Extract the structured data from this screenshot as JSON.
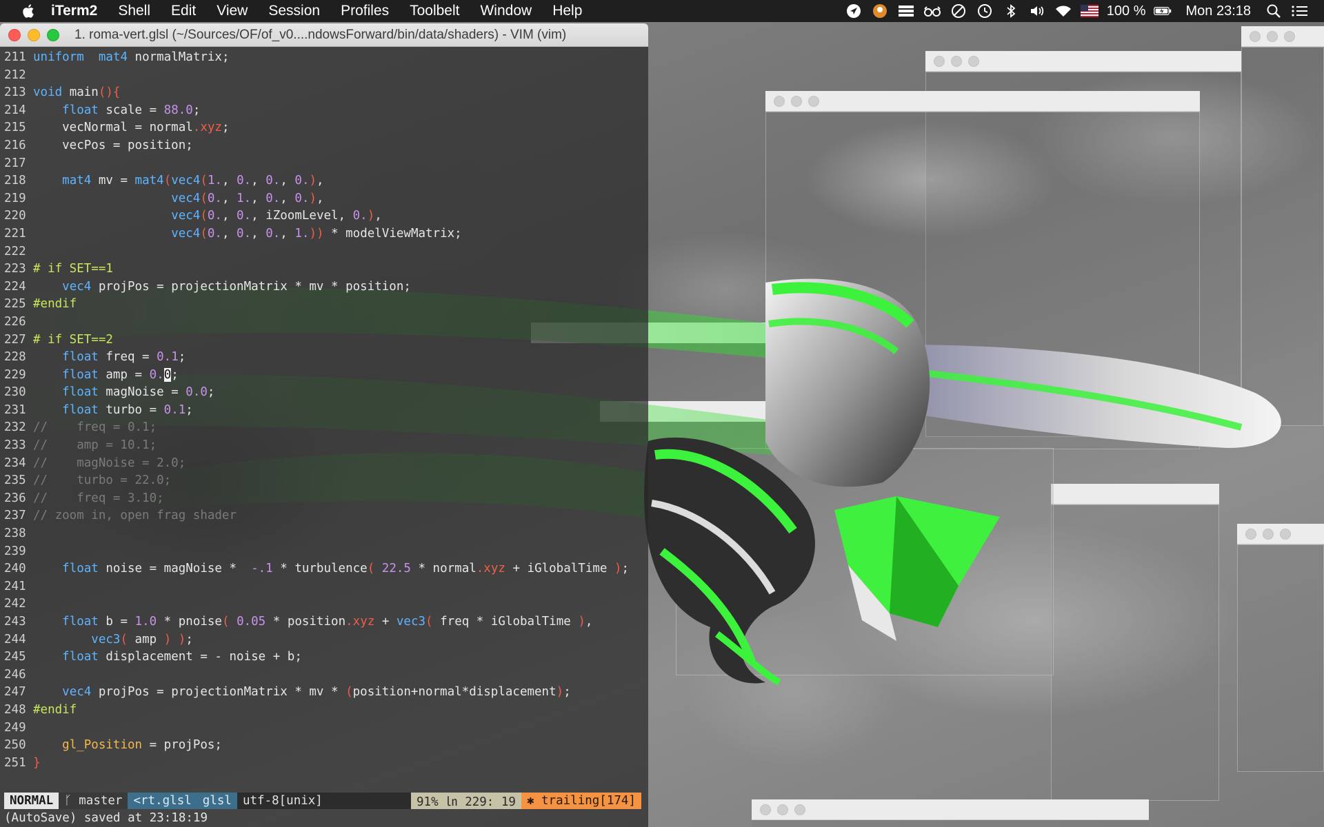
{
  "menubar": {
    "apple_icon": "apple-icon",
    "app_name": "iTerm2",
    "items": [
      "Shell",
      "Edit",
      "View",
      "Session",
      "Profiles",
      "Toolbelt",
      "Window",
      "Help"
    ],
    "status_icons": [
      "location-icon",
      "activity-icon",
      "stacks-icon",
      "glasses-icon",
      "do-not-disturb-icon",
      "time-machine-icon",
      "bluetooth-icon",
      "volume-icon",
      "wifi-icon",
      "flag-us-icon"
    ],
    "battery_text": "100 %",
    "battery_icon": "battery-charging-icon",
    "clock": "Mon 23:18",
    "search_icon": "spotlight-search-icon",
    "list_icon": "notification-center-icon"
  },
  "iterm": {
    "title": "1. roma-vert.glsl (~/Sources/OF/of_v0....ndowsForward/bin/data/shaders) - VIM (vim)",
    "lines": [
      {
        "n": "211",
        "tokens": [
          [
            "kw",
            "uniform"
          ],
          [
            "",
            "  "
          ],
          [
            "kw",
            "mat4"
          ],
          [
            "",
            " normalMatrix;"
          ]
        ]
      },
      {
        "n": "212",
        "tokens": []
      },
      {
        "n": "213",
        "tokens": [
          [
            "kw",
            "void"
          ],
          [
            "",
            " main"
          ],
          [
            "sw",
            "(){"
          ]
        ]
      },
      {
        "n": "214",
        "tokens": [
          [
            "",
            "    "
          ],
          [
            "kw",
            "float"
          ],
          [
            "",
            " scale = "
          ],
          [
            "num",
            "88.0"
          ],
          [
            "",
            ";"
          ]
        ]
      },
      {
        "n": "215",
        "tokens": [
          [
            "",
            "    vecNormal = normal"
          ],
          [
            "sw",
            ".xyz"
          ],
          [
            "",
            ";"
          ]
        ]
      },
      {
        "n": "216",
        "tokens": [
          [
            "",
            "    vecPos = position;"
          ]
        ]
      },
      {
        "n": "217",
        "tokens": []
      },
      {
        "n": "218",
        "tokens": [
          [
            "",
            "    "
          ],
          [
            "kw",
            "mat4"
          ],
          [
            "",
            " mv = "
          ],
          [
            "kw",
            "mat4"
          ],
          [
            "sw",
            "("
          ],
          [
            "kw",
            "vec4"
          ],
          [
            "sw",
            "("
          ],
          [
            "num",
            "1."
          ],
          [
            "",
            ", "
          ],
          [
            "num",
            "0."
          ],
          [
            "",
            ", "
          ],
          [
            "num",
            "0."
          ],
          [
            "",
            ", "
          ],
          [
            "num",
            "0."
          ],
          [
            "sw",
            ")"
          ],
          [
            "",
            ","
          ]
        ]
      },
      {
        "n": "219",
        "tokens": [
          [
            "",
            "                   "
          ],
          [
            "kw",
            "vec4"
          ],
          [
            "sw",
            "("
          ],
          [
            "num",
            "0."
          ],
          [
            "",
            ", "
          ],
          [
            "num",
            "1."
          ],
          [
            "",
            ", "
          ],
          [
            "num",
            "0."
          ],
          [
            "",
            ", "
          ],
          [
            "num",
            "0."
          ],
          [
            "sw",
            ")"
          ],
          [
            "",
            ","
          ]
        ]
      },
      {
        "n": "220",
        "tokens": [
          [
            "",
            "                   "
          ],
          [
            "kw",
            "vec4"
          ],
          [
            "sw",
            "("
          ],
          [
            "num",
            "0."
          ],
          [
            "",
            ", "
          ],
          [
            "num",
            "0."
          ],
          [
            "",
            ", iZoomLevel, "
          ],
          [
            "num",
            "0."
          ],
          [
            "sw",
            ")"
          ],
          [
            "",
            ","
          ]
        ]
      },
      {
        "n": "221",
        "tokens": [
          [
            "",
            "                   "
          ],
          [
            "kw",
            "vec4"
          ],
          [
            "sw",
            "("
          ],
          [
            "num",
            "0."
          ],
          [
            "",
            ", "
          ],
          [
            "num",
            "0."
          ],
          [
            "",
            ", "
          ],
          [
            "num",
            "0."
          ],
          [
            "",
            ", "
          ],
          [
            "num",
            "1."
          ],
          [
            "sw",
            "))"
          ],
          [
            "",
            " * modelViewMatrix;"
          ]
        ]
      },
      {
        "n": "222",
        "tokens": []
      },
      {
        "n": "223",
        "tokens": [
          [
            "pre",
            "# if SET==1"
          ]
        ]
      },
      {
        "n": "224",
        "tokens": [
          [
            "",
            "    "
          ],
          [
            "kw",
            "vec4"
          ],
          [
            "",
            " projPos = projectionMatrix * mv * position;"
          ]
        ]
      },
      {
        "n": "225",
        "tokens": [
          [
            "pre",
            "#endif"
          ]
        ]
      },
      {
        "n": "226",
        "tokens": []
      },
      {
        "n": "227",
        "tokens": [
          [
            "pre",
            "# if SET==2"
          ]
        ]
      },
      {
        "n": "228",
        "tokens": [
          [
            "",
            "    "
          ],
          [
            "kw",
            "float"
          ],
          [
            "",
            " freq = "
          ],
          [
            "num",
            "0.1"
          ],
          [
            "",
            ";"
          ]
        ]
      },
      {
        "n": "229",
        "tokens": [
          [
            "",
            "    "
          ],
          [
            "kw",
            "float"
          ],
          [
            "",
            " amp = "
          ],
          [
            "num",
            "0."
          ],
          [
            "cursor",
            "0"
          ],
          [
            "",
            ";"
          ]
        ]
      },
      {
        "n": "230",
        "tokens": [
          [
            "",
            "    "
          ],
          [
            "kw",
            "float"
          ],
          [
            "",
            " magNoise = "
          ],
          [
            "num",
            "0.0"
          ],
          [
            "",
            ";"
          ]
        ]
      },
      {
        "n": "231",
        "tokens": [
          [
            "",
            "    "
          ],
          [
            "kw",
            "float"
          ],
          [
            "",
            " turbo = "
          ],
          [
            "num",
            "0.1"
          ],
          [
            "",
            ";"
          ]
        ]
      },
      {
        "n": "232",
        "tokens": [
          [
            "cm",
            "//    freq = 0.1;"
          ]
        ]
      },
      {
        "n": "233",
        "tokens": [
          [
            "cm",
            "//    amp = 10.1;"
          ]
        ]
      },
      {
        "n": "234",
        "tokens": [
          [
            "cm",
            "//    magNoise = 2.0;"
          ]
        ]
      },
      {
        "n": "235",
        "tokens": [
          [
            "cm",
            "//    turbo = 22.0;"
          ]
        ]
      },
      {
        "n": "236",
        "tokens": [
          [
            "cm",
            "//    freq = 3.10;"
          ]
        ]
      },
      {
        "n": "237",
        "tokens": [
          [
            "cm",
            "// zoom in, open frag shader"
          ]
        ]
      },
      {
        "n": "238",
        "tokens": []
      },
      {
        "n": "239",
        "tokens": []
      },
      {
        "n": "240",
        "tokens": [
          [
            "",
            "    "
          ],
          [
            "kw",
            "float"
          ],
          [
            "",
            " noise = magNoise *  "
          ],
          [
            "num",
            "-.1"
          ],
          [
            "",
            " * turbulence"
          ],
          [
            "sw",
            "("
          ],
          [
            "",
            " "
          ],
          [
            "num",
            "22.5"
          ],
          [
            "",
            " * normal"
          ],
          [
            "sw",
            ".xyz"
          ],
          [
            "",
            " + iGlobalTime "
          ],
          [
            "sw",
            ")"
          ],
          [
            "",
            ";"
          ]
        ]
      },
      {
        "n": "241",
        "tokens": []
      },
      {
        "n": "242",
        "tokens": []
      },
      {
        "n": "243",
        "tokens": [
          [
            "",
            "    "
          ],
          [
            "kw",
            "float"
          ],
          [
            "",
            " b = "
          ],
          [
            "num",
            "1.0"
          ],
          [
            "",
            " * pnoise"
          ],
          [
            "sw",
            "("
          ],
          [
            "",
            " "
          ],
          [
            "num",
            "0.05"
          ],
          [
            "",
            " * position"
          ],
          [
            "sw",
            ".xyz"
          ],
          [
            "",
            " + "
          ],
          [
            "kw",
            "vec3"
          ],
          [
            "sw",
            "("
          ],
          [
            "",
            " freq * iGlobalTime "
          ],
          [
            "sw",
            ")"
          ],
          [
            "",
            ","
          ]
        ]
      },
      {
        "n": "244",
        "tokens": [
          [
            "",
            "        "
          ],
          [
            "kw",
            "vec3"
          ],
          [
            "sw",
            "("
          ],
          [
            "",
            " amp "
          ],
          [
            "sw",
            ")"
          ],
          [
            "",
            " "
          ],
          [
            "sw",
            ")"
          ],
          [
            "",
            ";"
          ]
        ]
      },
      {
        "n": "245",
        "tokens": [
          [
            "",
            "    "
          ],
          [
            "kw",
            "float"
          ],
          [
            "",
            " displacement = - noise + b;"
          ]
        ]
      },
      {
        "n": "246",
        "tokens": []
      },
      {
        "n": "247",
        "tokens": [
          [
            "",
            "    "
          ],
          [
            "kw",
            "vec4"
          ],
          [
            "",
            " projPos = projectionMatrix * mv * "
          ],
          [
            "sw",
            "("
          ],
          [
            "",
            "position+normal*displacement"
          ],
          [
            "sw",
            ")"
          ],
          [
            "",
            ";"
          ]
        ]
      },
      {
        "n": "248",
        "tokens": [
          [
            "pre",
            "#endif"
          ]
        ]
      },
      {
        "n": "249",
        "tokens": []
      },
      {
        "n": "250",
        "tokens": [
          [
            "",
            "    "
          ],
          [
            "fn",
            "gl_Position"
          ],
          [
            "",
            " = projPos;"
          ]
        ]
      },
      {
        "n": "251",
        "tokens": [
          [
            "sw",
            "}"
          ]
        ]
      }
    ],
    "status": {
      "mode": "NORMAL",
      "branch": "ᚴ master",
      "file": "<rt.glsl",
      "filetype": "glsl",
      "encoding": "utf-8[unix]",
      "position": "91% ㏑ 229: 19",
      "warning": "✱ trailing[174]"
    },
    "cmdline": "(AutoSave) saved at 23:18:19"
  },
  "colors": {
    "keyword": "#5fb4ff",
    "number": "#c792ea",
    "swizzle": "#ef5f47",
    "preprocessor": "#c8e85a",
    "comment": "#7a7a7a",
    "builtin": "#f5b94a",
    "shape_green": "#3df23d"
  }
}
